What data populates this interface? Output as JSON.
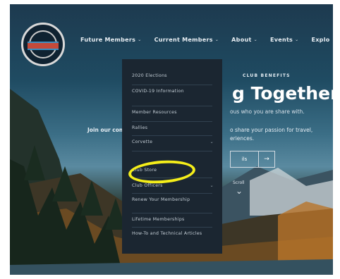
{
  "nav": {
    "items": [
      {
        "label": "Future Members",
        "caret": "⌄"
      },
      {
        "label": "Current Members",
        "caret": "⌄"
      },
      {
        "label": "About",
        "caret": "⌄"
      },
      {
        "label": "Events",
        "caret": "⌄"
      },
      {
        "label": "Explo"
      }
    ]
  },
  "dropdown": {
    "items": [
      {
        "label": "2020 Elections"
      },
      {
        "label": "COVID-19 Information"
      },
      {
        "label": "Member Resources"
      },
      {
        "label": "Rallies"
      },
      {
        "label": "Corvette",
        "caret": "⌄"
      },
      {
        "label": "Club Store"
      },
      {
        "label": "Club Officers",
        "caret": "⌄"
      },
      {
        "label": "Renew Your Membership"
      },
      {
        "label": "Lifetime Memberships"
      },
      {
        "label": "How-To and Technical Articles"
      }
    ]
  },
  "hero": {
    "eyebrow": "CLUB BENEFITS",
    "title": "g Together",
    "subtitle": "ous who you are share with.",
    "join_left": "Join our com",
    "join_right_1": "o share your passion for travel,",
    "join_right_2": "eriences.",
    "button_label": "ils",
    "button_arrow": "→",
    "scroll_label": "Scroll",
    "scroll_icon": "⌄"
  },
  "colors": {
    "highlight": "#f5ee1a",
    "dropdown_bg": "#1b2631"
  }
}
